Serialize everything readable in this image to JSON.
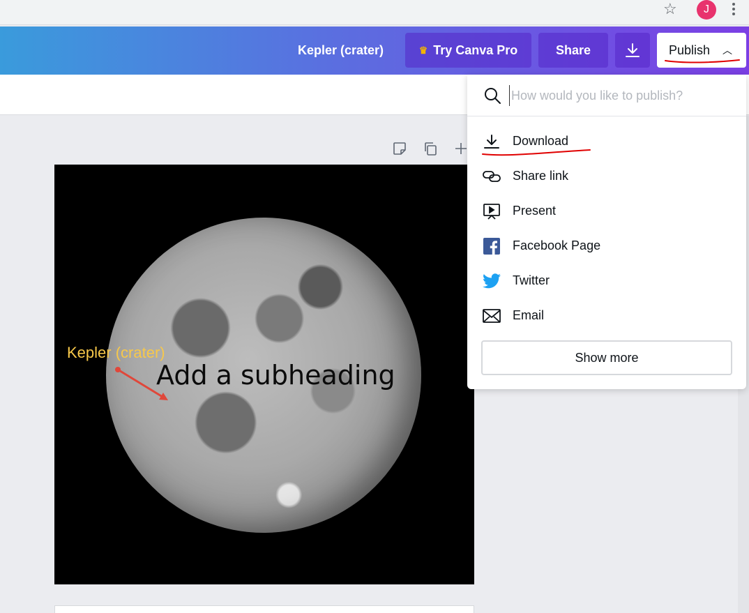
{
  "browser": {
    "profile_initial": "J",
    "icons": [
      "star-icon",
      "profile-avatar",
      "kebab-menu-icon"
    ]
  },
  "header": {
    "doc_title": "Kepler (crater)",
    "try_pro_label": "Try Canva Pro",
    "share_label": "Share",
    "publish_label": "Publish",
    "colors": {
      "gradient_start": "#3a9bdc",
      "gradient_end": "#7b3fe4",
      "crown": "#f4b400"
    }
  },
  "canvas": {
    "annotation_label": "Kepler (crater)",
    "subheading": "Add a subheading",
    "annotation_color": "#f7c84a",
    "arrow_color": "#e0473a"
  },
  "publish_menu": {
    "search_placeholder": "How would you like to publish?",
    "items": [
      {
        "label": "Download",
        "icon": "download-icon"
      },
      {
        "label": "Share link",
        "icon": "link-icon"
      },
      {
        "label": "Present",
        "icon": "present-icon"
      },
      {
        "label": "Facebook Page",
        "icon": "facebook-icon"
      },
      {
        "label": "Twitter",
        "icon": "twitter-icon"
      },
      {
        "label": "Email",
        "icon": "email-icon"
      }
    ],
    "show_more_label": "Show more"
  }
}
